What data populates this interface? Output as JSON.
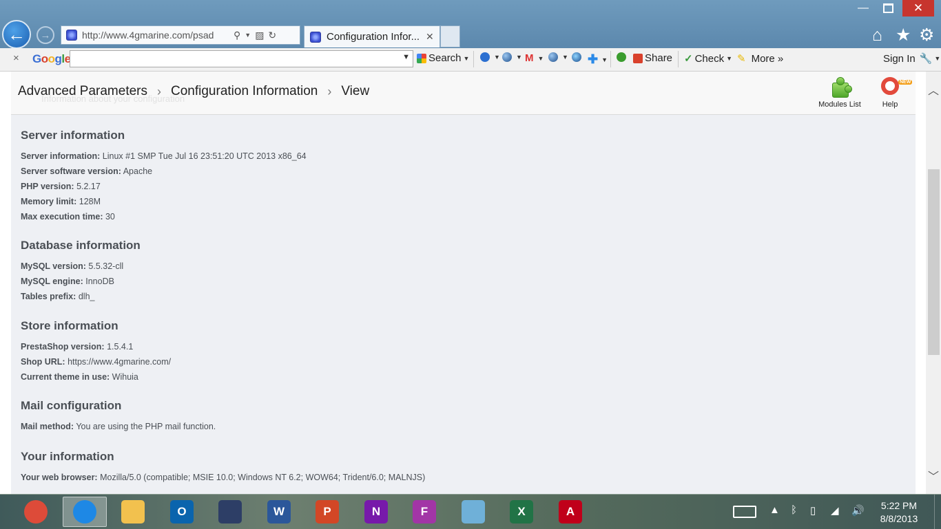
{
  "browser": {
    "address_url": "http://www.4gmarine.com/psad",
    "tab_title": "Configuration Infor...",
    "window_controls": {
      "minimize": "—",
      "close": "✕"
    }
  },
  "google_toolbar": {
    "close": "×",
    "logo": "Google",
    "search_label": "Search",
    "share_label": "Share",
    "check_label": "Check",
    "more_label": "More »",
    "sign_in_label": "Sign In"
  },
  "page": {
    "breadcrumb": [
      "Advanced Parameters",
      "Configuration Information",
      "View"
    ],
    "breadcrumb_sep": "›",
    "header_ghost": "Information about your configuration",
    "toolbar": {
      "modules_list": "Modules List",
      "help": "Help",
      "new_badge": "NEW"
    },
    "sections": [
      {
        "title": "Server information",
        "rows": [
          {
            "label": "Server information:",
            "value": "Linux #1 SMP Tue Jul 16 23:51:20 UTC 2013 x86_64"
          },
          {
            "label": "Server software version:",
            "value": "Apache"
          },
          {
            "label": "PHP version:",
            "value": "5.2.17"
          },
          {
            "label": "Memory limit:",
            "value": "128M"
          },
          {
            "label": "Max execution time:",
            "value": "30"
          }
        ]
      },
      {
        "title": "Database information",
        "rows": [
          {
            "label": "MySQL version:",
            "value": "5.5.32-cll"
          },
          {
            "label": "MySQL engine:",
            "value": "InnoDB"
          },
          {
            "label": "Tables prefix:",
            "value": "dlh_"
          }
        ]
      },
      {
        "title": "Store information",
        "rows": [
          {
            "label": "PrestaShop version:",
            "value": "1.5.4.1"
          },
          {
            "label": "Shop URL:",
            "value": "https://www.4gmarine.com/"
          },
          {
            "label": "Current theme in use:",
            "value": "Wihuia"
          }
        ]
      },
      {
        "title": "Mail configuration",
        "rows": [
          {
            "label": "Mail method:",
            "value": "You are using the PHP mail function."
          }
        ]
      },
      {
        "title": "Your information",
        "rows": [
          {
            "label": "Your web browser:",
            "value": "Mozilla/5.0 (compatible; MSIE 10.0; Windows NT 6.2; WOW64; Trident/6.0; MALNJS)"
          }
        ]
      }
    ]
  },
  "taskbar": {
    "apps": [
      {
        "name": "chrome",
        "color": "#dd4b39"
      },
      {
        "name": "internet-explorer",
        "color": "#1e88e5",
        "active": true
      },
      {
        "name": "file-explorer",
        "color": "#f2c14e"
      },
      {
        "name": "outlook",
        "color": "#0a64ad",
        "letter": "O"
      },
      {
        "name": "media-app",
        "color": "#2d3e66"
      },
      {
        "name": "word",
        "color": "#2b579a",
        "letter": "W"
      },
      {
        "name": "powerpoint",
        "color": "#d24726",
        "letter": "P"
      },
      {
        "name": "onenote",
        "color": "#7719aa",
        "letter": "N"
      },
      {
        "name": "f-app",
        "color": "#a235a6",
        "letter": "F"
      },
      {
        "name": "paint",
        "color": "#6fb0d8"
      },
      {
        "name": "excel",
        "color": "#217346",
        "letter": "X"
      },
      {
        "name": "acrobat",
        "color": "#c0001a",
        "letter": "A"
      }
    ],
    "clock_time": "5:22 PM",
    "clock_date": "8/8/2013"
  }
}
